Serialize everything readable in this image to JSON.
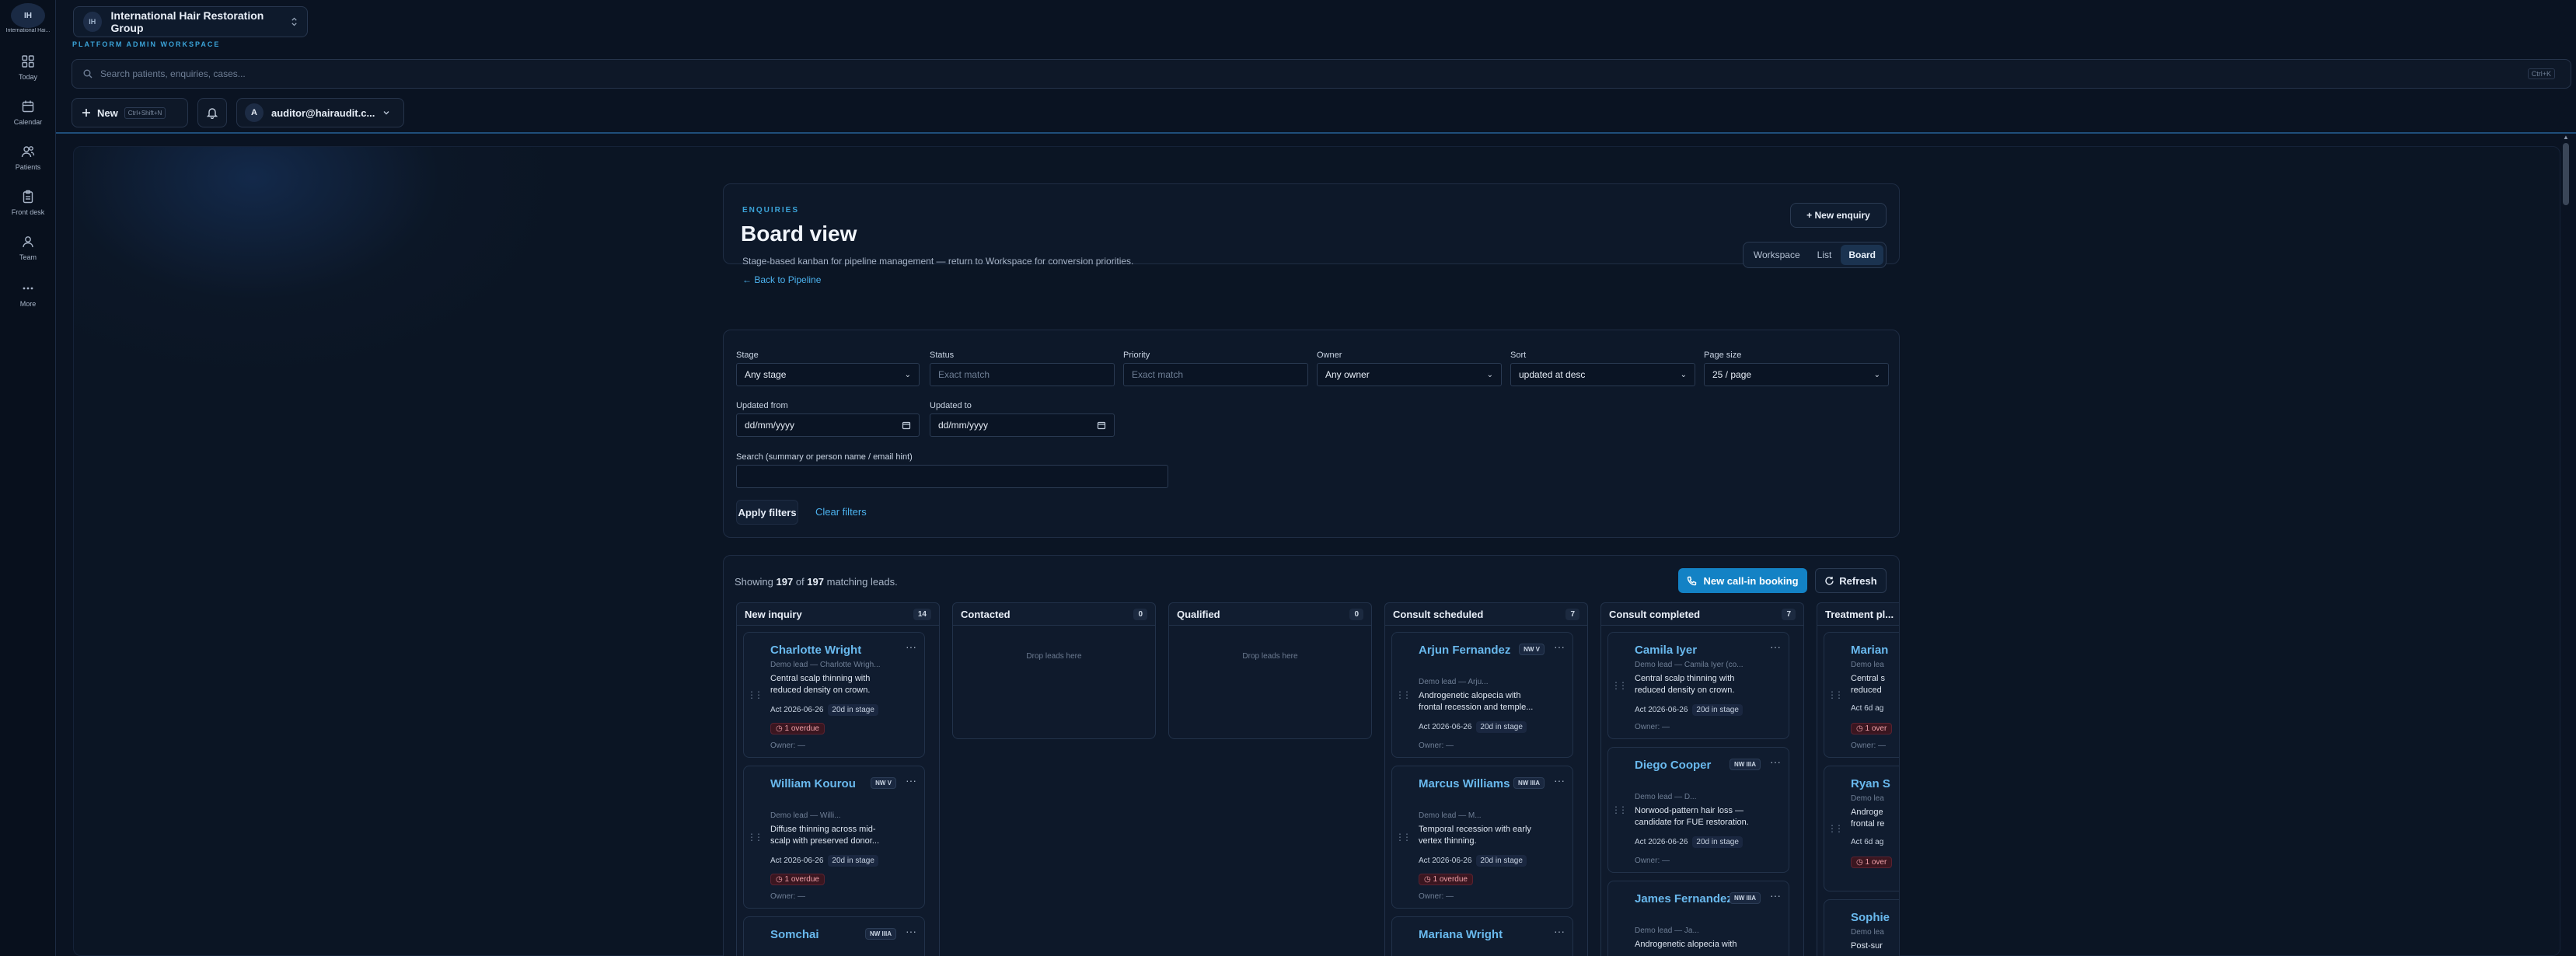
{
  "rail": {
    "org_avatar": "IH",
    "org_name": "International Hai...",
    "items": [
      {
        "label": "Today",
        "icon": "grid-icon"
      },
      {
        "label": "Calendar",
        "icon": "calendar-icon"
      },
      {
        "label": "Patients",
        "icon": "users-icon"
      },
      {
        "label": "Front desk",
        "icon": "clipboard-icon"
      },
      {
        "label": "Team",
        "icon": "team-icon"
      },
      {
        "label": "More",
        "icon": "more-icon"
      }
    ]
  },
  "topbar": {
    "org_badge": "IH",
    "org_name": "International Hair Restoration Group",
    "workspace_label": "PLATFORM ADMIN WORKSPACE",
    "search_placeholder": "Search patients, enquiries, cases...",
    "search_shortcut": "Ctrl+K",
    "new_label": "New",
    "new_shortcut": "Ctrl+Shift+N",
    "user_initial": "A",
    "user_email": "auditor@hairaudit.c..."
  },
  "header": {
    "eyebrow": "ENQUIRIES",
    "title": "Board view",
    "subtitle": "Stage-based kanban for pipeline management — return to Workspace for conversion priorities.",
    "back_link": "← Back to Pipeline",
    "new_enquiry": "+ New enquiry",
    "views": [
      "Workspace",
      "List",
      "Board"
    ],
    "active_view": "Board"
  },
  "filters": {
    "stage": {
      "label": "Stage",
      "value": "Any stage"
    },
    "status": {
      "label": "Status",
      "placeholder": "Exact match"
    },
    "priority": {
      "label": "Priority",
      "placeholder": "Exact match"
    },
    "owner": {
      "label": "Owner",
      "value": "Any owner"
    },
    "sort": {
      "label": "Sort",
      "value": "updated at desc"
    },
    "page_size": {
      "label": "Page size",
      "value": "25 / page"
    },
    "updated_from": {
      "label": "Updated from",
      "value": "dd/mm/yyyy"
    },
    "updated_to": {
      "label": "Updated to",
      "value": "dd/mm/yyyy"
    },
    "search": {
      "label": "Search (summary or person name / email hint)",
      "value": ""
    },
    "apply": "Apply filters",
    "clear": "Clear filters"
  },
  "board": {
    "showing_prefix": "Showing",
    "shown": "197",
    "of": "of",
    "total": "197",
    "showing_suffix": "matching leads.",
    "call_in": "New call-in booking",
    "refresh": "Refresh",
    "drop_text": "Drop leads here",
    "columns": [
      {
        "name": "New inquiry",
        "count": "14"
      },
      {
        "name": "Contacted",
        "count": "0"
      },
      {
        "name": "Qualified",
        "count": "0"
      },
      {
        "name": "Consult scheduled",
        "count": "7"
      },
      {
        "name": "Consult completed",
        "count": "7"
      },
      {
        "name": "Treatment pl...",
        "count": ""
      }
    ],
    "cards": {
      "c1": {
        "name": "Charlotte Wright",
        "meta": "Demo lead — Charlotte Wrigh...",
        "desc": "Central scalp thinning with reduced density on crown.",
        "act": "Act 2026-06-26",
        "stage": "20d in stage",
        "overdue": "1 overdue",
        "owner": "Owner: —"
      },
      "c2": {
        "name": "William Kourou",
        "nw": "NW V",
        "meta": "Demo lead — Willi...",
        "desc": "Diffuse thinning across mid-scalp with preserved donor...",
        "act": "Act 2026-06-26",
        "stage": "20d in stage",
        "overdue": "1 overdue",
        "owner": "Owner: —"
      },
      "c3": {
        "name": "Somchai",
        "nw": "NW IIIA"
      },
      "c4": {
        "name": "Arjun Fernandez",
        "nw": "NW V",
        "meta": "Demo lead — Arju...",
        "desc": "Androgenetic alopecia with frontal recession and temple...",
        "act": "Act 2026-06-26",
        "stage": "20d in stage",
        "owner": "Owner: —"
      },
      "c5": {
        "name": "Marcus Williams",
        "nw": "NW IIIA",
        "meta": "Demo lead — M...",
        "desc": "Temporal recession with early vertex thinning.",
        "act": "Act 2026-06-26",
        "stage": "20d in stage",
        "overdue": "1 overdue",
        "owner": "Owner: —"
      },
      "c6": {
        "name": "Mariana Wright"
      },
      "c7": {
        "name": "Camila Iyer",
        "meta": "Demo lead — Camila Iyer (co...",
        "desc": "Central scalp thinning with reduced density on crown.",
        "act": "Act 2026-06-26",
        "stage": "20d in stage",
        "owner": "Owner: —"
      },
      "c8": {
        "name": "Diego Cooper",
        "nw": "NW IIIA",
        "meta": "Demo lead — D...",
        "desc": "Norwood-pattern hair loss — candidate for FUE restoration.",
        "act": "Act 2026-06-26",
        "stage": "20d in stage",
        "owner": "Owner: —"
      },
      "c9": {
        "name": "James Fernandez",
        "nw": "NW IIIA",
        "meta": "Demo lead — Ja...",
        "desc": "Androgenetic alopecia with"
      },
      "c10": {
        "name": "Marian",
        "meta": "Demo lea",
        "desc": "Central s reduced",
        "act": "Act 6d ag",
        "overdue": "1 over",
        "owner": "Owner: —"
      },
      "c11": {
        "name": "Ryan S",
        "meta": "Demo lea",
        "desc": "Androge frontal re",
        "act": "Act 6d ag",
        "overdue": "1 over"
      },
      "c12": {
        "name": "Sophie",
        "meta": "Demo lea",
        "desc": "Post-sur"
      }
    }
  }
}
